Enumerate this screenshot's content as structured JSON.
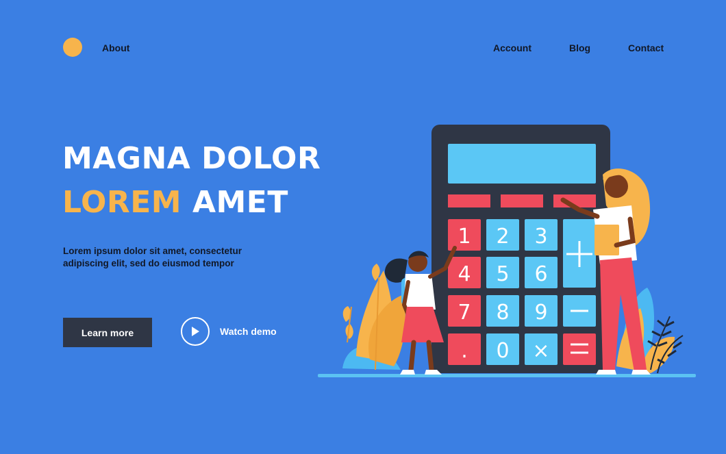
{
  "nav": {
    "about": "About",
    "account": "Account",
    "blog": "Blog",
    "contact": "Contact"
  },
  "hero": {
    "title_line1": "MAGNA DOLOR",
    "title_accent": "LOREM",
    "title_rest": "AMET",
    "description": "Lorem ipsum dolor sit amet, consectetur adipiscing elit, sed do eiusmod tempor",
    "learn_more": "Learn more",
    "watch_demo": "Watch demo"
  },
  "calculator": {
    "keys": [
      "1",
      "2",
      "3",
      "4",
      "5",
      "6",
      "7",
      "8",
      "9",
      ".",
      "0",
      "×"
    ]
  },
  "colors": {
    "background": "#3b7fe3",
    "accent": "#f7b44c",
    "button": "#2f3645"
  }
}
